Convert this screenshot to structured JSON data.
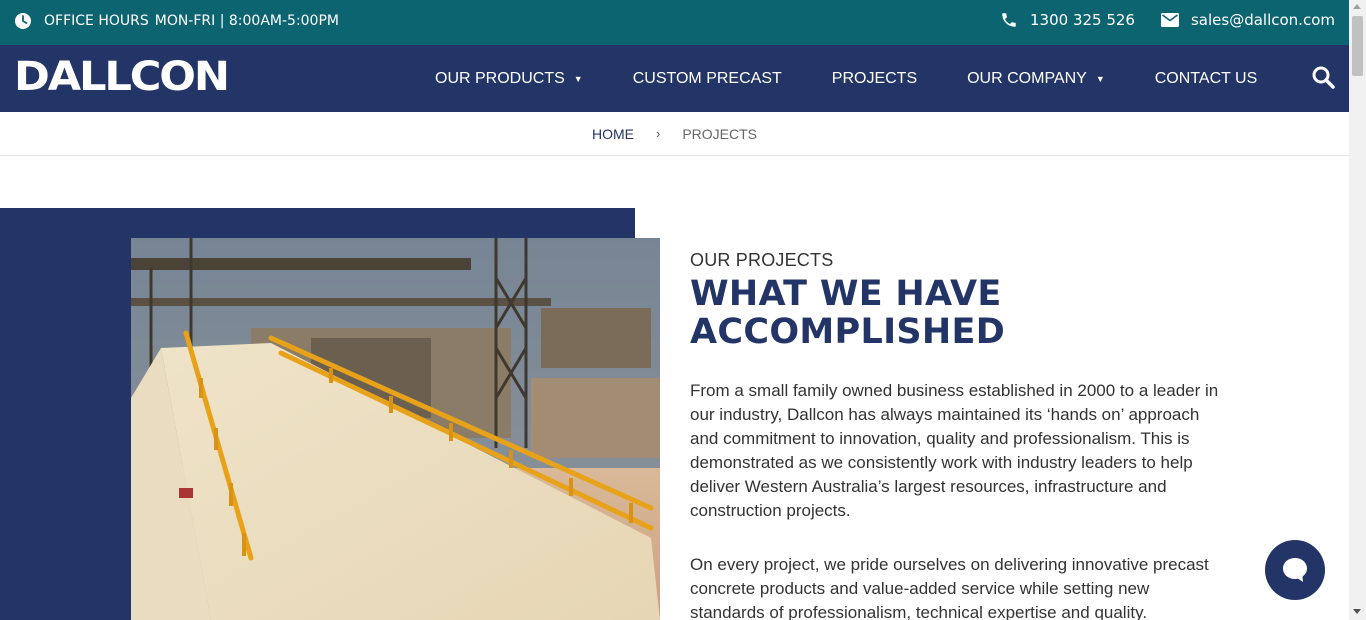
{
  "topbar": {
    "hours_label": "OFFICE HOURS",
    "hours_value": "MON-FRI | 8:00AM-5:00PM",
    "phone": "1300 325 526",
    "email": "sales@dallcon.com"
  },
  "nav": {
    "logo_text": "DALLCON",
    "items": [
      {
        "label": "OUR PRODUCTS",
        "has_dropdown": true
      },
      {
        "label": "CUSTOM PRECAST",
        "has_dropdown": false
      },
      {
        "label": "PROJECTS",
        "has_dropdown": false
      },
      {
        "label": "OUR COMPANY",
        "has_dropdown": true
      },
      {
        "label": "CONTACT US",
        "has_dropdown": false
      }
    ],
    "search_icon": "search-icon"
  },
  "breadcrumb": {
    "home": "HOME",
    "separator": "›",
    "current": "PROJECTS"
  },
  "main": {
    "eyebrow": "OUR PROJECTS",
    "headline_line1": "WHAT WE HAVE",
    "headline_line2": "ACCOMPLISHED",
    "paragraph1": "From a small family owned business established in 2000 to a leader in our industry, Dallcon has always maintained its ‘hands on’ approach and commitment to innovation, quality and professionalism. This is demonstrated as we consistently work with industry leaders to help deliver Western Australia’s largest resources, infrastructure and construction projects.",
    "paragraph2": "On every project, we pride ourselves on delivering innovative precast concrete products and value-added service while setting new standards of professionalism, technical expertise and quality."
  },
  "chat": {
    "icon": "chat-bubble-icon"
  },
  "colors": {
    "topbar": "#0c6470",
    "navy": "#233466",
    "white": "#ffffff"
  }
}
